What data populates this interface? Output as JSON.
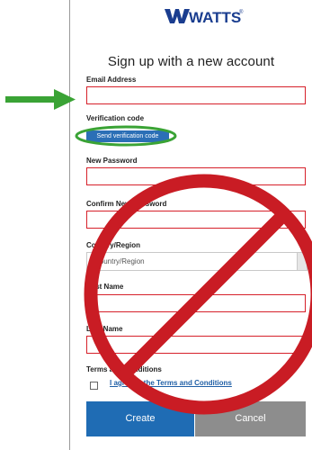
{
  "brand": {
    "name": "WATTS",
    "reg_mark": "®"
  },
  "page_title": "Sign up with a new account",
  "fields": {
    "email_label": "Email Address",
    "verification_label": "Verification code",
    "send_code_label": "Send verification code",
    "new_password_label": "New Password",
    "confirm_password_label": "Confirm New Password",
    "country_label": "Country/Region",
    "country_value": "Country/Region",
    "first_name_label": "First Name",
    "last_name_label": "Last Name",
    "terms_label": "Terms and Conditions",
    "terms_link": "I agree to the Terms and Conditions"
  },
  "buttons": {
    "create": "Create",
    "cancel": "Cancel"
  },
  "colors": {
    "accent": "#1f6cb4",
    "error_border": "#d6202a",
    "annotation_green": "#3aa335",
    "prohibition_red": "#c91c24"
  },
  "icons": {
    "arrow": "green-arrow-icon",
    "oval": "green-oval-highlight",
    "no_sign": "no-sign-icon"
  }
}
